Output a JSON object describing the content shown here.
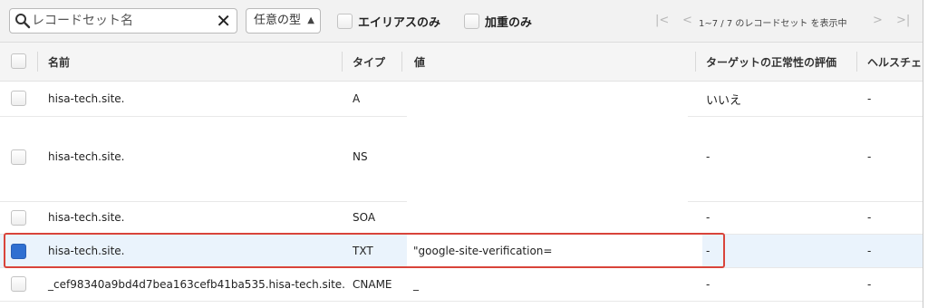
{
  "toolbar": {
    "search_placeholder": "レコードセット名",
    "select_label": "任意の型",
    "alias_only_label": "エイリアスのみ",
    "weighted_only_label": "加重のみ",
    "pager_text": "1~7 / 7 のレコードセット を表示中"
  },
  "table": {
    "columns": [
      "名前",
      "タイプ",
      "値",
      "ターゲットの正常性の評価",
      "ヘルスチェ"
    ],
    "rows": [
      {
        "name": "hisa-tech.site.",
        "type": "A",
        "value": "",
        "eval": "いいえ",
        "health": "-",
        "checked": false
      },
      {
        "name": "hisa-tech.site.",
        "type": "NS",
        "value": "",
        "eval": "-",
        "health": "-",
        "checked": false
      },
      {
        "name": "hisa-tech.site.",
        "type": "SOA",
        "value": "",
        "eval": "-",
        "health": "-",
        "checked": false
      },
      {
        "name": "hisa-tech.site.",
        "type": "TXT",
        "value": "\"google-site-verification=",
        "eval": "-",
        "health": "-",
        "checked": true
      },
      {
        "name": "_cef98340a9bd4d7bea163cefb41ba535.hisa-tech.site.",
        "type": "CNAME",
        "value": "_",
        "eval": "-",
        "health": "-",
        "checked": false
      }
    ]
  },
  "colors": {
    "highlight": "#d9443a",
    "checkbox_checked": "#2f6fd1",
    "selected_row": "#eaf3fc"
  }
}
